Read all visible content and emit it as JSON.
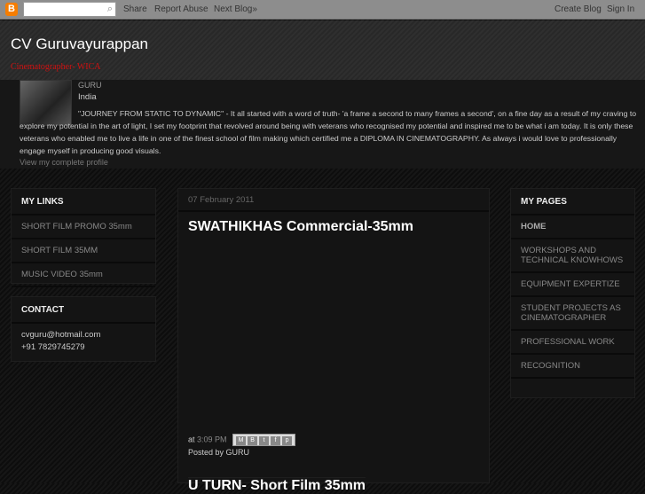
{
  "navbar": {
    "logo": "B",
    "search_icon": "search-icon",
    "share": "Share",
    "report": "Report Abuse",
    "next": "Next Blog»",
    "create": "Create Blog",
    "signin": "Sign In"
  },
  "header": {
    "title": "CV Guruvayurappan",
    "description": "Cinematographer- WICA"
  },
  "profile": {
    "name": "GURU",
    "location": "India",
    "about": "\"JOURNEY FROM STATIC TO DYNAMIC\" - It all started with a word of truth- 'a frame a second to many frames a second', on a fine day as a result of my craving to explore my potential in the art of light, I set my footprint that revolved around being with veterans who recognised my potential and inspired me to be what i am today. It is only these veterans who enabled me to live a life in one of the finest school of film making which certified me a DIPLOMA IN CINEMATOGRAPHY. As always i would love to professionally engage myself in producing good visuals.",
    "view": "View my complete profile"
  },
  "my_links": {
    "title": "MY LINKS",
    "items": [
      "SHORT FILM PROMO 35mm",
      "SHORT FILM 35MM",
      "MUSIC VIDEO 35mm"
    ]
  },
  "contact": {
    "title": "CONTACT",
    "email": "cvguru@hotmail.com",
    "phone": "+91 7829745279"
  },
  "post": {
    "date": "07 February 2011",
    "title": "SWATHIKHAS Commercial-35mm",
    "at": "at",
    "time": "3:09 PM",
    "posted_by": "Posted by GURU",
    "share_icons": [
      "M",
      "B",
      "t",
      "f",
      "p"
    ],
    "next_title": "U TURN- Short Film 35mm"
  },
  "my_pages": {
    "title": "MY PAGES",
    "items": [
      "HOME",
      "WORKSHOPS AND TECHNICAL KNOWHOWS",
      "EQUIPMENT EXPERTIZE",
      "STUDENT PROJECTS AS CINEMATOGRAPHER",
      "PROFESSIONAL WORK",
      "RECOGNITION"
    ]
  }
}
